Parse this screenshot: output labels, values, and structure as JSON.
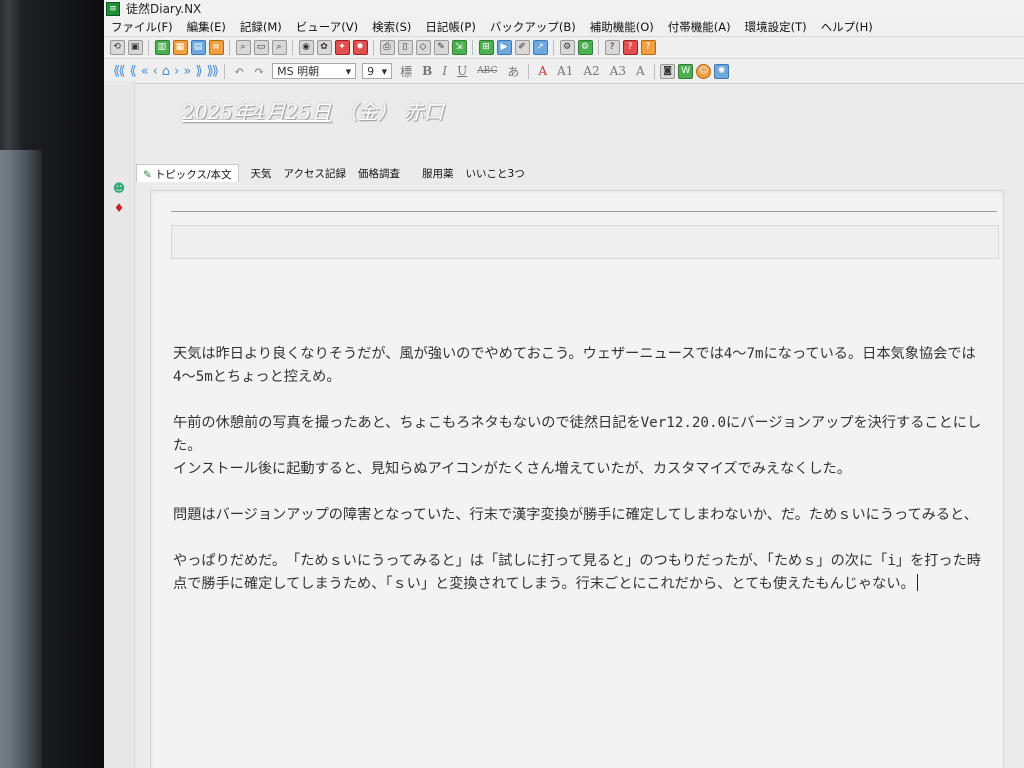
{
  "window": {
    "title": "徒然Diary.NX"
  },
  "menu": [
    "ファイル(F)",
    "編集(E)",
    "記録(M)",
    "ビューア(V)",
    "検索(S)",
    "日記帳(P)",
    "バックアップ(B)",
    "補助機能(O)",
    "付帯機能(A)",
    "環境設定(T)",
    "ヘルプ(H)"
  ],
  "format": {
    "font": "MS 明朝",
    "size": "9"
  },
  "entry": {
    "date": "2025年4月25日",
    "weekday": "（金）",
    "weather": "赤口"
  },
  "tabs": [
    "トピックス/本文",
    "天気",
    "アクセス記録",
    "価格調査",
    "服用薬",
    "いいこと3つ"
  ],
  "body": {
    "p1": "天気は昨日より良くなりそうだが、風が強いのでやめておこう。ウェザーニュースでは4〜7mになっている。日本気象協会では4〜5mとちょっと控えめ。",
    "p2a": "午前の休憩前の写真を撮ったあと、ちょこもろネタもないので徒然日記をVer12.20.0にバージョンアップを決行することにした。",
    "p2b": "インストール後に起動すると、見知らぬアイコンがたくさん増えていたが、カスタマイズでみえなくした。",
    "p3": "問題はバージョンアップの障害となっていた、行末で漢字変換が勝手に確定してしまわないか、だ。ためｓいにうってみると、",
    "p4": "やっぱりだめだ。　「ためｓいにうってみると」は「試しに打って見ると」のつもりだったが、「ためｓ」の次に「i」を打った時点で勝手に確定してしまうため、「ｓい」と変換されてしまう。行末ごとにこれだから、とても使えたもんじゃない。"
  }
}
